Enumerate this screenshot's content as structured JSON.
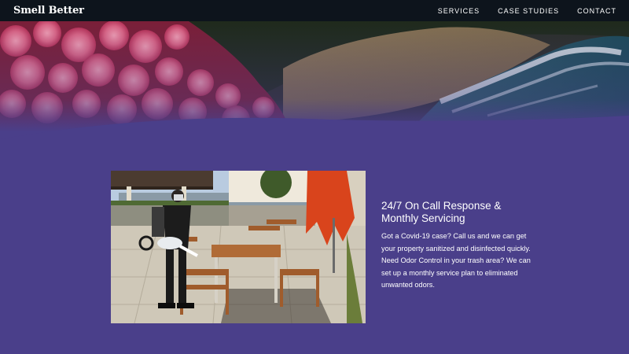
{
  "nav": {
    "brand": "Smell Better",
    "links": [
      "SERVICES",
      "CASE STUDIES",
      "CONTACT"
    ]
  },
  "section": {
    "heading_line1": "24/7 On Call Response &",
    "heading_line2": "Monthly Servicing",
    "body": "Got a Covid-19 case? Call us and we can get your property sanitized and disinfected quickly. Need Odor Control in your trash area? We can set up a monthly service plan to eliminated unwanted odors."
  },
  "colors": {
    "nav_bg": "#0d141c",
    "page_bg": "#4a3f8a",
    "text": "#ffffff"
  }
}
